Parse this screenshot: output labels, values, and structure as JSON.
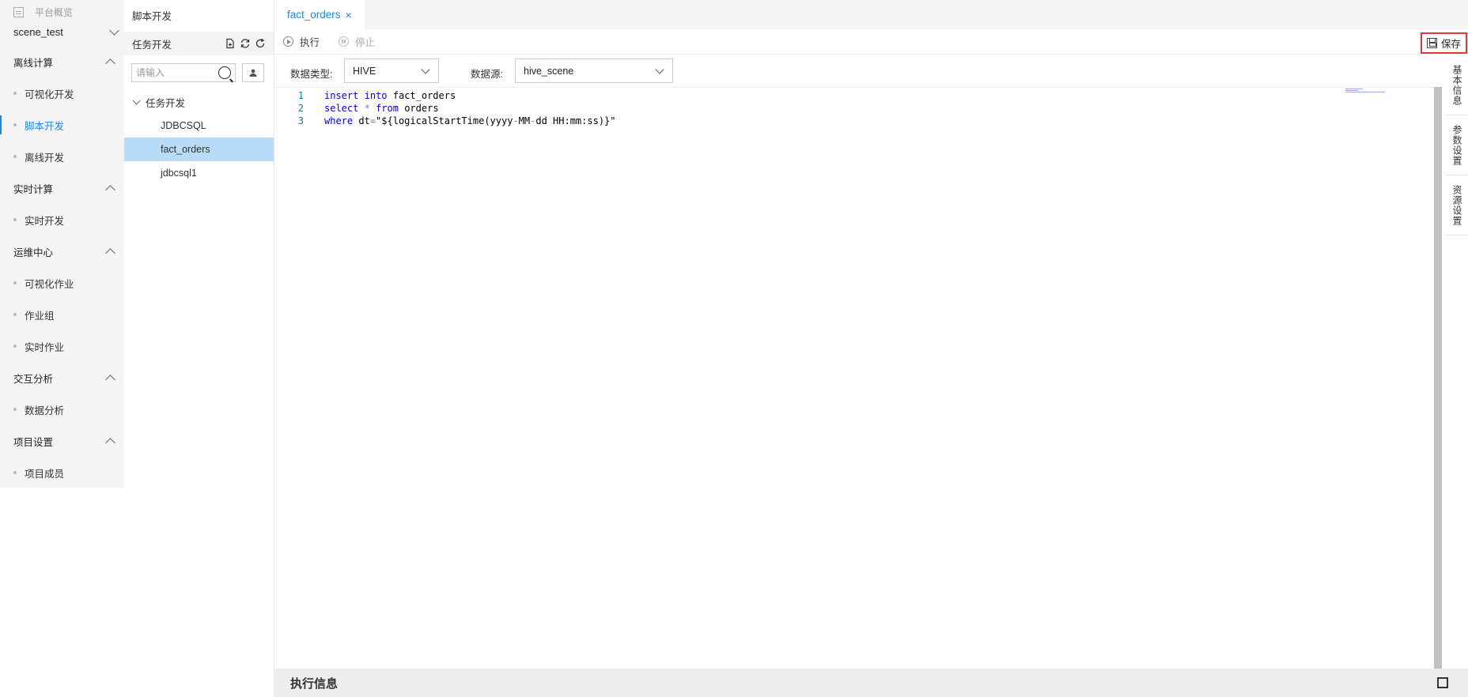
{
  "nav": {
    "overview_label": "平台概览",
    "project": "scene_test",
    "groups": [
      {
        "label": "离线计算",
        "items": [
          "可视化开发",
          "脚本开发",
          "离线开发"
        ]
      },
      {
        "label": "实时计算",
        "items": [
          "实时开发"
        ]
      },
      {
        "label": "运维中心",
        "items": [
          "可视化作业",
          "作业组",
          "实时作业"
        ]
      },
      {
        "label": "交互分析",
        "items": [
          "数据分析"
        ]
      },
      {
        "label": "项目设置",
        "items": [
          "项目成员"
        ]
      }
    ],
    "active_item": "脚本开发"
  },
  "tree": {
    "title": "脚本开发",
    "header_label": "任务开发",
    "search_placeholder": "请输入",
    "folder_label": "任务开发",
    "files": [
      "JDBCSQL",
      "fact_orders",
      "jdbcsql1"
    ],
    "selected_file": "fact_orders"
  },
  "tabs": [
    {
      "label": "fact_orders",
      "close": "×"
    }
  ],
  "toolbar": {
    "run_label": "执行",
    "stop_label": "停止",
    "save_label": "保存"
  },
  "config": {
    "data_type_label": "数据类型:",
    "data_type_value": "HIVE",
    "datasource_label": "数据源:",
    "datasource_value": "hive_scene"
  },
  "editor": {
    "line_numbers": [
      "1",
      "2",
      "3"
    ]
  },
  "side_tabs": [
    "基本信息",
    "参数设置",
    "资源设置"
  ],
  "exec_panel": {
    "title": "执行信息"
  },
  "colors": {
    "accent": "#1e88e5",
    "selected_row": "#b8dcf7",
    "highlight_border": "#e53935"
  }
}
